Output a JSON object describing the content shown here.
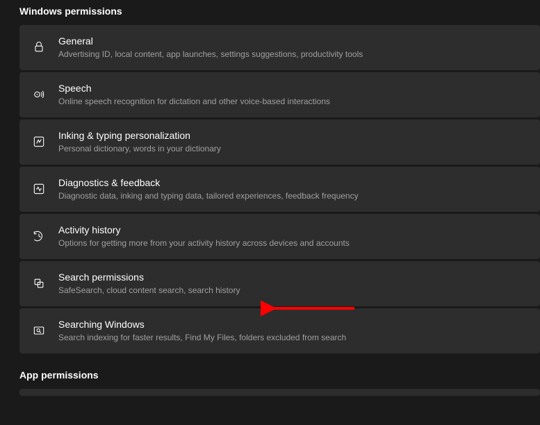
{
  "sections": {
    "windows_permissions": {
      "header": "Windows permissions",
      "items": [
        {
          "title": "General",
          "subtitle": "Advertising ID, local content, app launches, settings suggestions, productivity tools"
        },
        {
          "title": "Speech",
          "subtitle": "Online speech recognition for dictation and other voice-based interactions"
        },
        {
          "title": "Inking & typing personalization",
          "subtitle": "Personal dictionary, words in your dictionary"
        },
        {
          "title": "Diagnostics & feedback",
          "subtitle": "Diagnostic data, inking and typing data, tailored experiences, feedback frequency"
        },
        {
          "title": "Activity history",
          "subtitle": "Options for getting more from your activity history across devices and accounts"
        },
        {
          "title": "Search permissions",
          "subtitle": "SafeSearch, cloud content search, search history"
        },
        {
          "title": "Searching Windows",
          "subtitle": "Search indexing for faster results, Find My Files, folders excluded from search"
        }
      ]
    },
    "app_permissions": {
      "header": "App permissions"
    }
  },
  "annotation": {
    "arrow_color": "#ff0000"
  }
}
